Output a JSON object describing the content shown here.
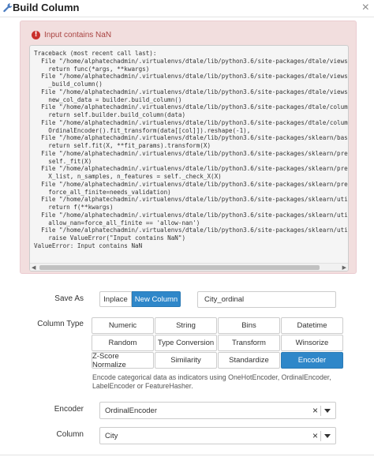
{
  "window": {
    "title": "Build Column",
    "close_glyph": "×"
  },
  "error": {
    "message": "Input contains NaN",
    "traceback": [
      "Traceback (most recent call last):",
      "  File \"/home/alphatechadmin/.virtualenvs/dtale/lib/python3.6/site-packages/dtale/views.py\", line",
      "    return func(*args, **kwargs)",
      "  File \"/home/alphatechadmin/.virtualenvs/dtale/lib/python3.6/site-packages/dtale/views.py\", line",
      "    _build_column()",
      "  File \"/home/alphatechadmin/.virtualenvs/dtale/lib/python3.6/site-packages/dtale/views.py\", line",
      "    new_col_data = builder.build_column()",
      "  File \"/home/alphatechadmin/.virtualenvs/dtale/lib/python3.6/site-packages/dtale/column_builders",
      "    return self.builder.build_column(data)",
      "  File \"/home/alphatechadmin/.virtualenvs/dtale/lib/python3.6/site-packages/dtale/column_builders",
      "    OrdinalEncoder().fit_transform(data[[col]]).reshape(-1),",
      "  File \"/home/alphatechadmin/.virtualenvs/dtale/lib/python3.6/site-packages/sklearn/base.py\", lin",
      "    return self.fit(X, **fit_params).transform(X)",
      "  File \"/home/alphatechadmin/.virtualenvs/dtale/lib/python3.6/site-packages/sklearn/preprocessing",
      "    self._fit(X)",
      "  File \"/home/alphatechadmin/.virtualenvs/dtale/lib/python3.6/site-packages/sklearn/preprocessing",
      "    X_list, n_samples, n_features = self._check_X(X)",
      "  File \"/home/alphatechadmin/.virtualenvs/dtale/lib/python3.6/site-packages/sklearn/preprocessing",
      "    force_all_finite=needs_validation)",
      "  File \"/home/alphatechadmin/.virtualenvs/dtale/lib/python3.6/site-packages/sklearn/utils/validat",
      "    return f(**kwargs)",
      "  File \"/home/alphatechadmin/.virtualenvs/dtale/lib/python3.6/site-packages/sklearn/utils/validat",
      "    allow_nan=force_all_finite == 'allow-nan')",
      "  File \"/home/alphatechadmin/.virtualenvs/dtale/lib/python3.6/site-packages/sklearn/utils/validat",
      "    raise ValueError(\"Input contains NaN\")",
      "ValueError: Input contains NaN"
    ]
  },
  "form": {
    "save_as": {
      "label": "Save As",
      "options": [
        "Inplace",
        "New Column"
      ],
      "selected": "New Column",
      "column_name": "City_ordinal"
    },
    "column_type": {
      "label": "Column Type",
      "options": [
        "Numeric",
        "String",
        "Bins",
        "Datetime",
        "Random",
        "Type Conversion",
        "Transform",
        "Winsorize",
        "Z-Score Normalize",
        "Similarity",
        "Standardize",
        "Encoder"
      ],
      "selected": "Encoder",
      "description": "Encode categorical data as indicators using OneHotEncoder, OrdinalEncoder, LabelEncoder or FeatureHasher."
    },
    "encoder": {
      "label": "Encoder",
      "value": "OrdinalEncoder",
      "clear": "×"
    },
    "column": {
      "label": "Column",
      "value": "City",
      "clear": "×"
    }
  },
  "icons": {
    "title_icon": "wrench-icon",
    "error_icon": "exclamation-circle-icon",
    "colors": {
      "primary": "#2f87c9",
      "error_bg": "#f2dede",
      "error_text": "#a94442"
    }
  }
}
